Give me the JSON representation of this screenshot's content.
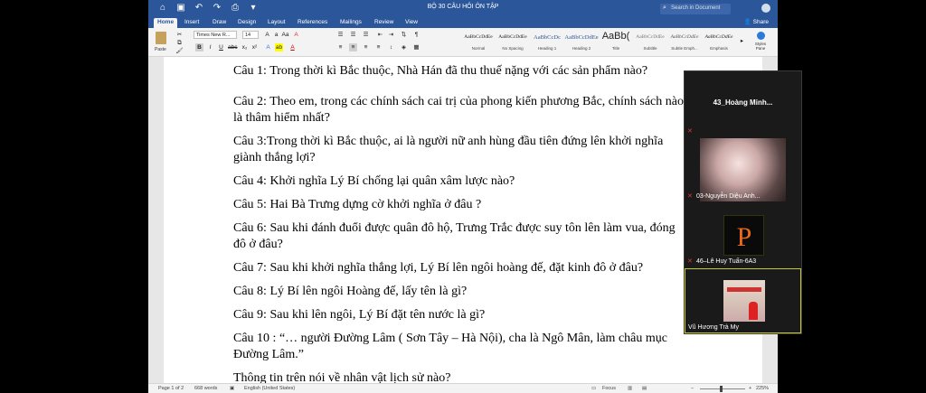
{
  "titlebar": {
    "title": "BỘ 30 CÂU HỎI ÔN TẬP",
    "search_placeholder": "Search in Document",
    "share_label": "Share"
  },
  "tabs": [
    "Home",
    "Insert",
    "Draw",
    "Design",
    "Layout",
    "References",
    "Mailings",
    "Review",
    "View"
  ],
  "ribbon": {
    "paste_label": "Paste",
    "font_name": "Times New R...",
    "font_size": "14",
    "styles": [
      {
        "preview": "AaBbCcDdEe",
        "name": "Normal"
      },
      {
        "preview": "AaBbCcDdEe",
        "name": "No Spacing"
      },
      {
        "preview": "AaBbCcDc",
        "name": "Heading 1"
      },
      {
        "preview": "AaBbCcDdEe",
        "name": "Heading 2"
      },
      {
        "preview": "AaBb(",
        "name": "Title"
      },
      {
        "preview": "AaBbCcDdEe",
        "name": "Subtitle"
      },
      {
        "preview": "AaBbCcDdEe",
        "name": "Subtle Emph..."
      },
      {
        "preview": "AaBbCcDdEe",
        "name": "Emphasis"
      }
    ],
    "styles_pane_label": "Styles Pane"
  },
  "document": {
    "lines": [
      "Câu 1: Trong thời kì Bắc thuộc, Nhà Hán đã thu thuế nặng với các sản phẩm nào?",
      "Câu 2: Theo em, trong các chính sách cai trị của phong kiến phương Bắc, chính sách nào",
      "là thâm hiểm nhất?",
      "Câu 3:Trong thời kì Bắc thuộc, ai là người nữ anh hùng đầu tiên đứng lên khởi nghĩa",
      "giành thắng lợi?",
      "Câu 4: Khởi nghĩa Lý Bí chống lại quân xâm lược nào?",
      "Câu 5: Hai Bà Trưng dựng cờ khởi nghĩa ở đâu ?",
      "Câu 6: Sau khi đánh đuổi được quân đô hộ, Trưng Trắc được suy tôn lên làm vua, đóng",
      "đô ở đâu?",
      "Câu 7: Sau khi khởi nghĩa thắng lợi, Lý Bí lên ngôi hoàng đế, đặt kinh đô ở đâu?",
      "Câu 8: Lý Bí lên ngôi Hoàng đế, lấy tên là gì?",
      "Câu 9: Sau khi lên ngôi, Lý Bí đặt tên nước là gì?",
      "Câu 10 : “… người Đường Lâm ( Sơn Tây – Hà Nội), cha là Ngô Mân, làm châu mục",
      "Đường Lâm.”",
      "Thông tin trên nói về nhân vật lịch sử nào?"
    ]
  },
  "statusbar": {
    "page": "Page 1 of 2",
    "words": "668 words",
    "language": "English (United States)",
    "focus": "Focus",
    "zoom": "225%"
  },
  "participants": [
    {
      "name": "43_Hoàng  Minh..."
    },
    {
      "name": "03-Nguyễn Diệu Anh..."
    },
    {
      "name": "46–Lê Huy Tuấn-6A3"
    },
    {
      "name": "Vũ Hương Trà My"
    }
  ],
  "colors": {
    "word_blue": "#2b579a",
    "active_border": "#c8c832"
  }
}
